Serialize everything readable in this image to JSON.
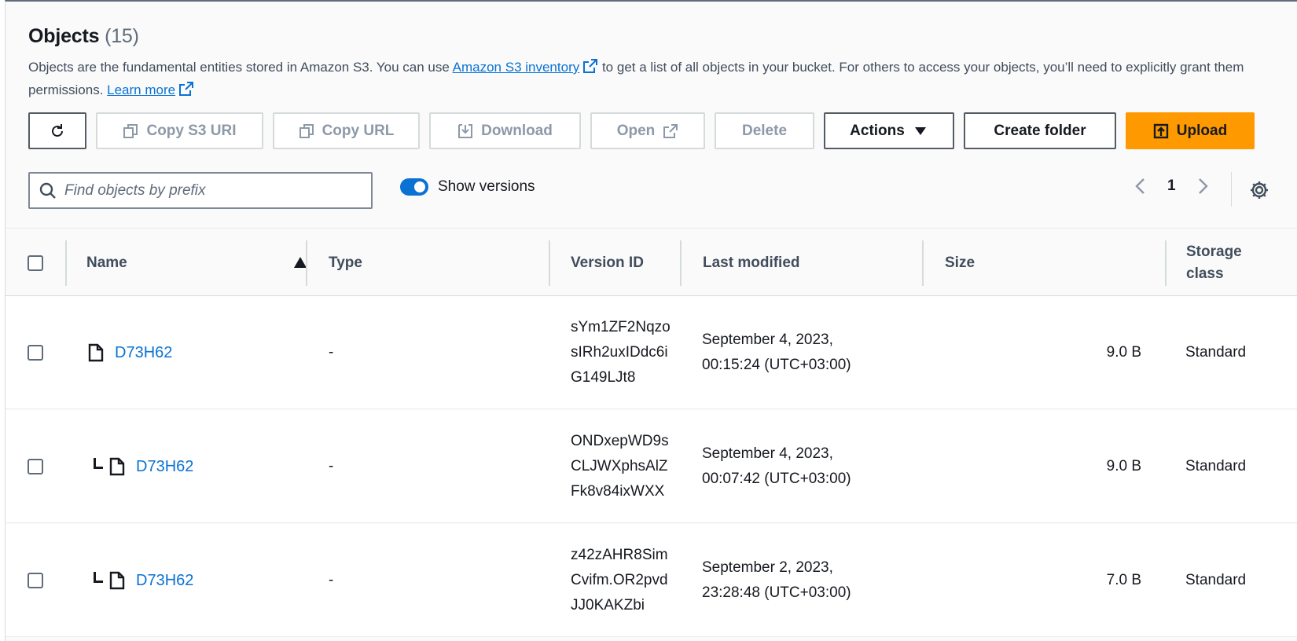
{
  "header": {
    "title": "Objects",
    "count": "(15)",
    "desc_part1": "Objects are the fundamental entities stored in Amazon S3. You can use ",
    "inventory_link": "Amazon S3 inventory",
    "desc_part2": " to get a list of all objects in your bucket. For others to access your objects, you’ll need to explicitly grant them permissions. ",
    "learn_more_link": "Learn more"
  },
  "toolbar": {
    "copy_s3_uri": "Copy S3 URI",
    "copy_url": "Copy URL",
    "download": "Download",
    "open": "Open",
    "delete": "Delete",
    "actions": "Actions",
    "create_folder": "Create folder",
    "upload": "Upload"
  },
  "filter": {
    "placeholder": "Find objects by prefix",
    "show_versions_label": "Show versions",
    "show_versions_on": true,
    "page": "1"
  },
  "columns": {
    "name": "Name",
    "type": "Type",
    "version_id": "Version ID",
    "last_modified": "Last modified",
    "size": "Size",
    "storage_class": "Storage class"
  },
  "rows": [
    {
      "name": "D73H62",
      "type": "-",
      "version_id": "sYm1ZF2NqzosIRh2uxIDdc6iG149LJt8",
      "last_modified": "September 4, 2023, 00:15:24 (UTC+03:00)",
      "size": "9.0 B",
      "storage_class": "Standard",
      "is_version": false
    },
    {
      "name": "D73H62",
      "type": "-",
      "version_id": "ONDxepWD9sCLJWXphsAlZFk8v84ixWXX",
      "last_modified": "September 4, 2023, 00:07:42 (UTC+03:00)",
      "size": "9.0 B",
      "storage_class": "Standard",
      "is_version": true
    },
    {
      "name": "D73H62",
      "type": "-",
      "version_id": "z42zAHR8SimCvifm.OR2pvdJJ0KAKZbi",
      "last_modified": "September 2, 2023, 23:28:48 (UTC+03:00)",
      "size": "7.0 B",
      "storage_class": "Standard",
      "is_version": true
    }
  ],
  "colors": {
    "link": "#0972d3",
    "primary": "#ff9900",
    "disabled_text": "#8d99a8"
  }
}
